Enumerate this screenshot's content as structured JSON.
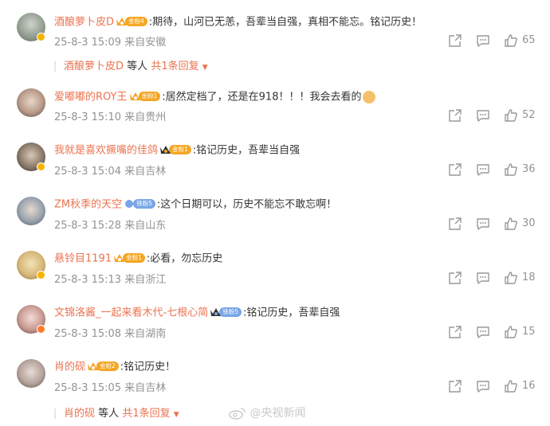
{
  "comments": [
    {
      "username": "酒酿萝卜皮D",
      "fan_badge": "金粉4",
      "fan_type": "gold",
      "text": ":期待，山河已无恙，吾辈当自强，真相不能忘。铭记历史！",
      "date": "25-8-3 15:09",
      "location": "来自安徽",
      "likes": "65",
      "replies": {
        "name": "酒酿萝卜皮D",
        "deng": "等人",
        "count": "共1条回复"
      }
    },
    {
      "username": "爱嘟嘟的ROY王",
      "fan_badge": "金粉1",
      "fan_type": "gold",
      "text": ":居然定档了，还是在918！！！我会去看的",
      "date": "25-8-3 15:10",
      "location": "来自贵州",
      "likes": "52"
    },
    {
      "username": "我就是喜欢撅嘴的佳鸽",
      "fan_badge": "金粉1",
      "fan_type": "gold",
      "text": ":铭记历史，吾辈当自强",
      "date": "25-8-3 15:04",
      "location": "来自吉林",
      "likes": "36"
    },
    {
      "username": "ZM秋季的天空",
      "fan_badge": "铁粉5",
      "fan_type": "iron",
      "text": ":这个日期可以，历史不能忘不敢忘啊！",
      "date": "25-8-3 15:28",
      "location": "来自山东",
      "likes": "30"
    },
    {
      "username": "悬铃目1191",
      "fan_badge": "金粉1",
      "fan_type": "gold",
      "text": ":必看，勿忘历史",
      "date": "25-8-3 15:13",
      "location": "来自浙江",
      "likes": "18"
    },
    {
      "username": "文锦洛酱_一起来看木代-七根心简",
      "fan_badge": "铁粉5",
      "fan_type": "iron",
      "text": ":铭记历史，吾辈自强",
      "date": "25-8-3 15:08",
      "location": "来自湖南",
      "likes": "15"
    },
    {
      "username": "肖的砚",
      "fan_badge": "金粉2",
      "fan_type": "gold",
      "text": ":铭记历史！",
      "date": "25-8-3 15:05",
      "location": "来自吉林",
      "likes": "16",
      "replies": {
        "name": "肖的砚",
        "deng": "等人",
        "count": "共1条回复"
      }
    }
  ],
  "watermark": "@央视新闻",
  "colors": {
    "username": "#eb7350",
    "meta": "#939393",
    "gold_badge": "#f5a623",
    "iron_badge": "#79a6e6"
  }
}
